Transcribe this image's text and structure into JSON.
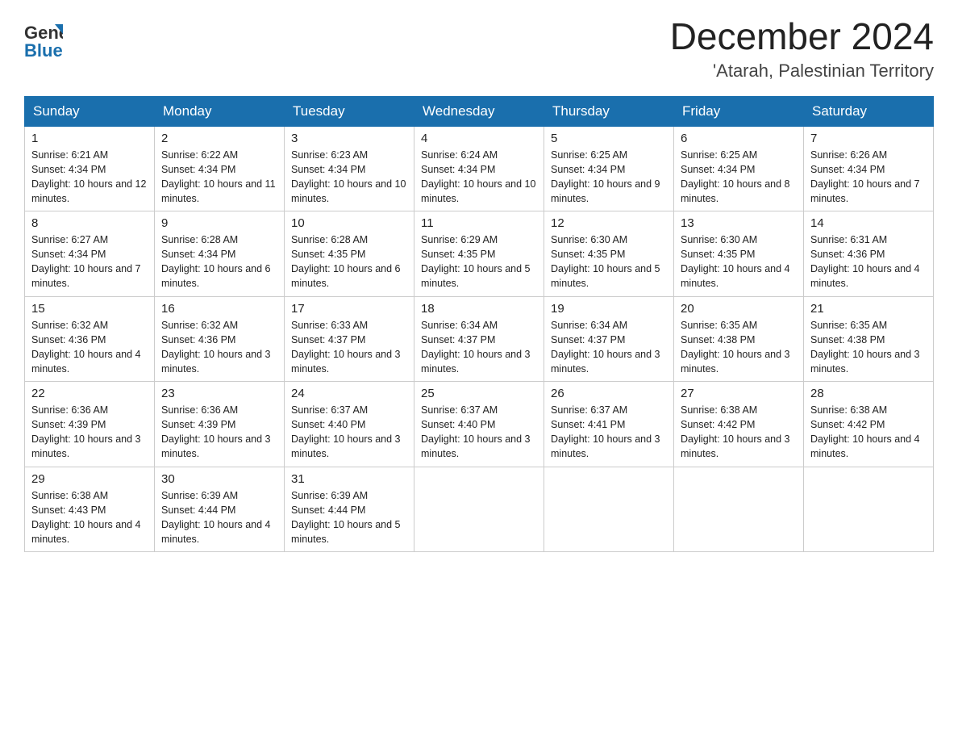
{
  "header": {
    "logo_general": "General",
    "logo_blue": "Blue",
    "month_title": "December 2024",
    "location": "'Atarah, Palestinian Territory"
  },
  "columns": [
    "Sunday",
    "Monday",
    "Tuesday",
    "Wednesday",
    "Thursday",
    "Friday",
    "Saturday"
  ],
  "weeks": [
    [
      {
        "day": "1",
        "sunrise": "6:21 AM",
        "sunset": "4:34 PM",
        "daylight": "10 hours and 12 minutes."
      },
      {
        "day": "2",
        "sunrise": "6:22 AM",
        "sunset": "4:34 PM",
        "daylight": "10 hours and 11 minutes."
      },
      {
        "day": "3",
        "sunrise": "6:23 AM",
        "sunset": "4:34 PM",
        "daylight": "10 hours and 10 minutes."
      },
      {
        "day": "4",
        "sunrise": "6:24 AM",
        "sunset": "4:34 PM",
        "daylight": "10 hours and 10 minutes."
      },
      {
        "day": "5",
        "sunrise": "6:25 AM",
        "sunset": "4:34 PM",
        "daylight": "10 hours and 9 minutes."
      },
      {
        "day": "6",
        "sunrise": "6:25 AM",
        "sunset": "4:34 PM",
        "daylight": "10 hours and 8 minutes."
      },
      {
        "day": "7",
        "sunrise": "6:26 AM",
        "sunset": "4:34 PM",
        "daylight": "10 hours and 7 minutes."
      }
    ],
    [
      {
        "day": "8",
        "sunrise": "6:27 AM",
        "sunset": "4:34 PM",
        "daylight": "10 hours and 7 minutes."
      },
      {
        "day": "9",
        "sunrise": "6:28 AM",
        "sunset": "4:34 PM",
        "daylight": "10 hours and 6 minutes."
      },
      {
        "day": "10",
        "sunrise": "6:28 AM",
        "sunset": "4:35 PM",
        "daylight": "10 hours and 6 minutes."
      },
      {
        "day": "11",
        "sunrise": "6:29 AM",
        "sunset": "4:35 PM",
        "daylight": "10 hours and 5 minutes."
      },
      {
        "day": "12",
        "sunrise": "6:30 AM",
        "sunset": "4:35 PM",
        "daylight": "10 hours and 5 minutes."
      },
      {
        "day": "13",
        "sunrise": "6:30 AM",
        "sunset": "4:35 PM",
        "daylight": "10 hours and 4 minutes."
      },
      {
        "day": "14",
        "sunrise": "6:31 AM",
        "sunset": "4:36 PM",
        "daylight": "10 hours and 4 minutes."
      }
    ],
    [
      {
        "day": "15",
        "sunrise": "6:32 AM",
        "sunset": "4:36 PM",
        "daylight": "10 hours and 4 minutes."
      },
      {
        "day": "16",
        "sunrise": "6:32 AM",
        "sunset": "4:36 PM",
        "daylight": "10 hours and 3 minutes."
      },
      {
        "day": "17",
        "sunrise": "6:33 AM",
        "sunset": "4:37 PM",
        "daylight": "10 hours and 3 minutes."
      },
      {
        "day": "18",
        "sunrise": "6:34 AM",
        "sunset": "4:37 PM",
        "daylight": "10 hours and 3 minutes."
      },
      {
        "day": "19",
        "sunrise": "6:34 AM",
        "sunset": "4:37 PM",
        "daylight": "10 hours and 3 minutes."
      },
      {
        "day": "20",
        "sunrise": "6:35 AM",
        "sunset": "4:38 PM",
        "daylight": "10 hours and 3 minutes."
      },
      {
        "day": "21",
        "sunrise": "6:35 AM",
        "sunset": "4:38 PM",
        "daylight": "10 hours and 3 minutes."
      }
    ],
    [
      {
        "day": "22",
        "sunrise": "6:36 AM",
        "sunset": "4:39 PM",
        "daylight": "10 hours and 3 minutes."
      },
      {
        "day": "23",
        "sunrise": "6:36 AM",
        "sunset": "4:39 PM",
        "daylight": "10 hours and 3 minutes."
      },
      {
        "day": "24",
        "sunrise": "6:37 AM",
        "sunset": "4:40 PM",
        "daylight": "10 hours and 3 minutes."
      },
      {
        "day": "25",
        "sunrise": "6:37 AM",
        "sunset": "4:40 PM",
        "daylight": "10 hours and 3 minutes."
      },
      {
        "day": "26",
        "sunrise": "6:37 AM",
        "sunset": "4:41 PM",
        "daylight": "10 hours and 3 minutes."
      },
      {
        "day": "27",
        "sunrise": "6:38 AM",
        "sunset": "4:42 PM",
        "daylight": "10 hours and 3 minutes."
      },
      {
        "day": "28",
        "sunrise": "6:38 AM",
        "sunset": "4:42 PM",
        "daylight": "10 hours and 4 minutes."
      }
    ],
    [
      {
        "day": "29",
        "sunrise": "6:38 AM",
        "sunset": "4:43 PM",
        "daylight": "10 hours and 4 minutes."
      },
      {
        "day": "30",
        "sunrise": "6:39 AM",
        "sunset": "4:44 PM",
        "daylight": "10 hours and 4 minutes."
      },
      {
        "day": "31",
        "sunrise": "6:39 AM",
        "sunset": "4:44 PM",
        "daylight": "10 hours and 5 minutes."
      },
      null,
      null,
      null,
      null
    ]
  ]
}
